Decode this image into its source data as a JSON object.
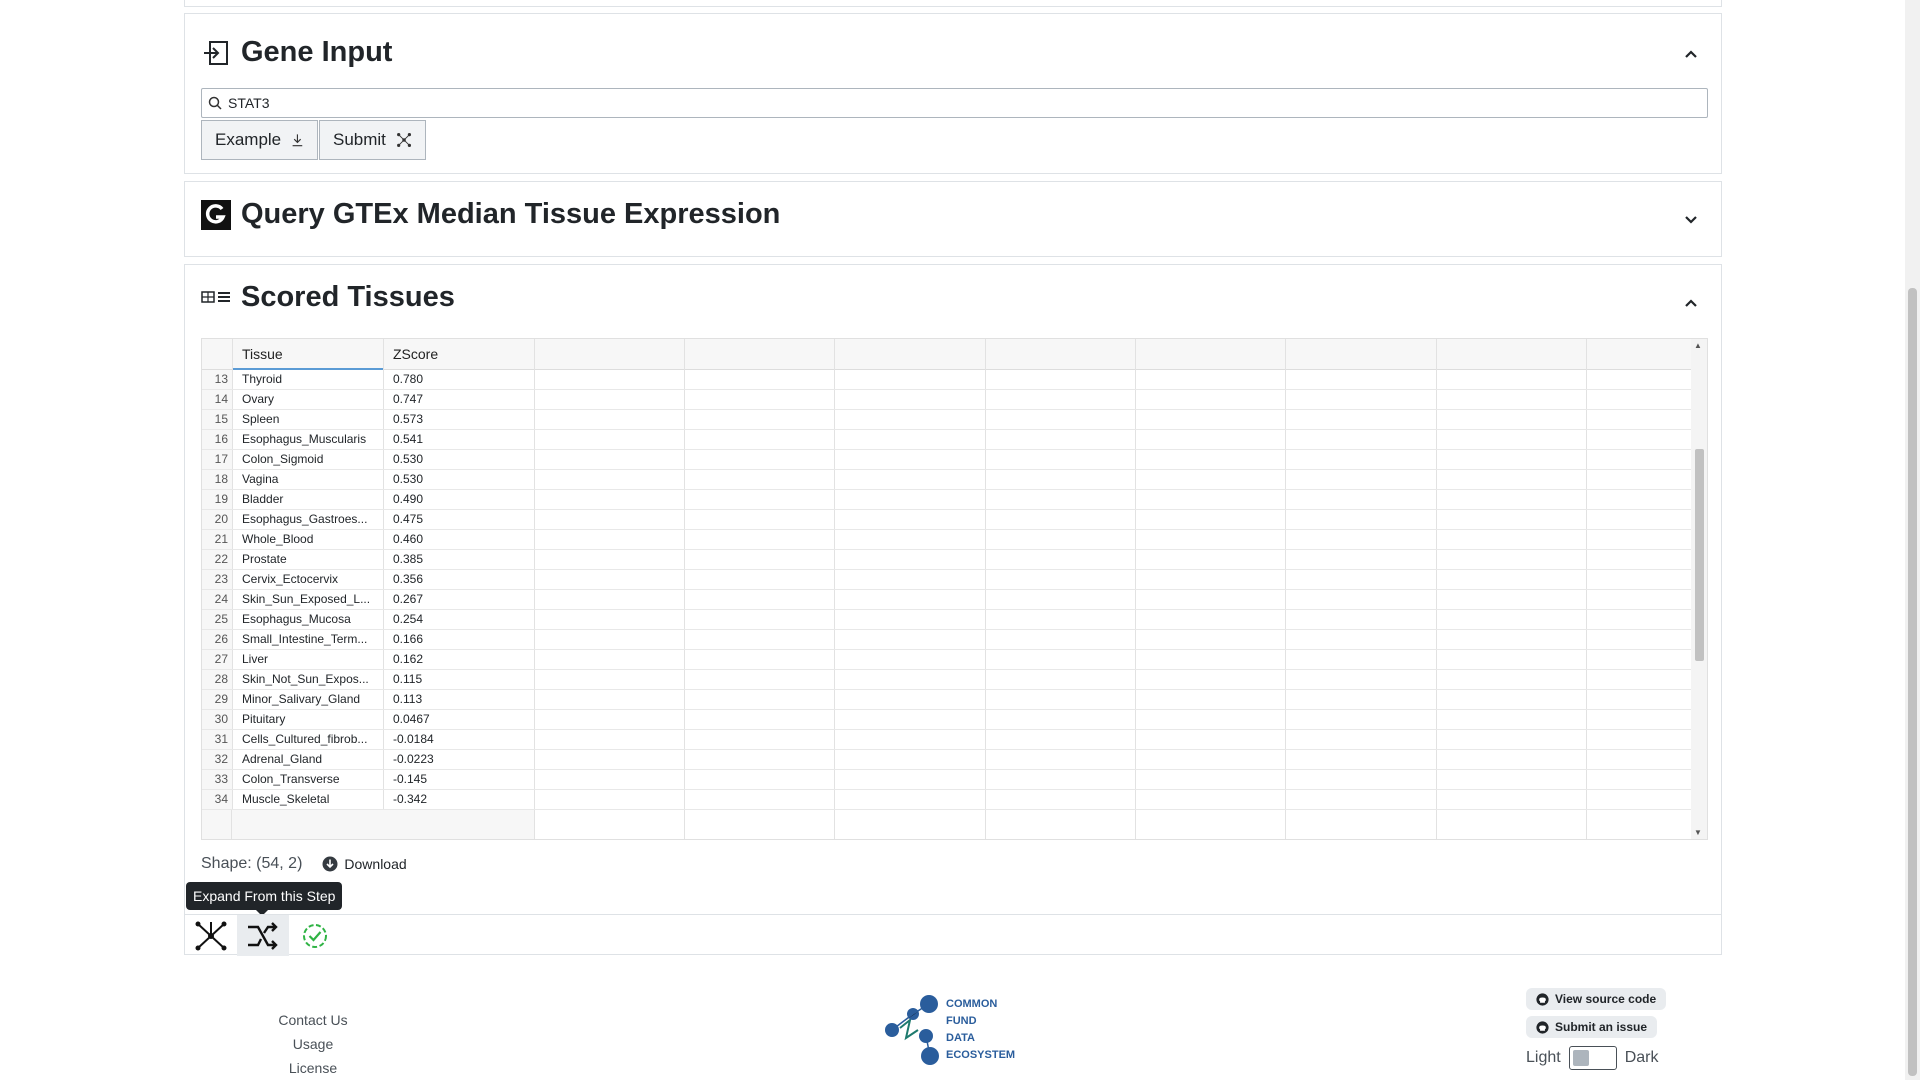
{
  "gene_input": {
    "title": "Gene Input",
    "search_value": "STAT3",
    "example_label": "Example",
    "submit_label": "Submit"
  },
  "gtex": {
    "title": "Query GTEx Median Tissue Expression"
  },
  "scored": {
    "title": "Scored Tissues",
    "columns": [
      "Tissue",
      "ZScore"
    ],
    "rows": [
      {
        "idx": "13",
        "tissue": "Thyroid",
        "zscore": "0.780"
      },
      {
        "idx": "14",
        "tissue": "Ovary",
        "zscore": "0.747"
      },
      {
        "idx": "15",
        "tissue": "Spleen",
        "zscore": "0.573"
      },
      {
        "idx": "16",
        "tissue": "Esophagus_Muscularis",
        "zscore": "0.541"
      },
      {
        "idx": "17",
        "tissue": "Colon_Sigmoid",
        "zscore": "0.530"
      },
      {
        "idx": "18",
        "tissue": "Vagina",
        "zscore": "0.530"
      },
      {
        "idx": "19",
        "tissue": "Bladder",
        "zscore": "0.490"
      },
      {
        "idx": "20",
        "tissue": "Esophagus_Gastroes...",
        "zscore": "0.475"
      },
      {
        "idx": "21",
        "tissue": "Whole_Blood",
        "zscore": "0.460"
      },
      {
        "idx": "22",
        "tissue": "Prostate",
        "zscore": "0.385"
      },
      {
        "idx": "23",
        "tissue": "Cervix_Ectocervix",
        "zscore": "0.356"
      },
      {
        "idx": "24",
        "tissue": "Skin_Sun_Exposed_L...",
        "zscore": "0.267"
      },
      {
        "idx": "25",
        "tissue": "Esophagus_Mucosa",
        "zscore": "0.254"
      },
      {
        "idx": "26",
        "tissue": "Small_Intestine_Term...",
        "zscore": "0.166"
      },
      {
        "idx": "27",
        "tissue": "Liver",
        "zscore": "0.162"
      },
      {
        "idx": "28",
        "tissue": "Skin_Not_Sun_Expos...",
        "zscore": "0.115"
      },
      {
        "idx": "29",
        "tissue": "Minor_Salivary_Gland",
        "zscore": "0.113"
      },
      {
        "idx": "30",
        "tissue": "Pituitary",
        "zscore": "0.0467"
      },
      {
        "idx": "31",
        "tissue": "Cells_Cultured_fibrob...",
        "zscore": "-0.0184"
      },
      {
        "idx": "32",
        "tissue": "Adrenal_Gland",
        "zscore": "-0.0223"
      },
      {
        "idx": "33",
        "tissue": "Colon_Transverse",
        "zscore": "-0.145"
      },
      {
        "idx": "34",
        "tissue": "Muscle_Skeletal",
        "zscore": "-0.342"
      }
    ],
    "shape_text": "Shape: (54, 2)",
    "download_label": "Download",
    "tooltip": "Expand From this Step"
  },
  "footer": {
    "contact": "Contact Us",
    "license": "Usage License",
    "logo_lines": [
      "COMMON",
      "FUND",
      "DATA",
      "ECOSYSTEM"
    ],
    "view_source": "View source code",
    "submit_issue": "Submit an issue",
    "theme_light": "Light",
    "theme_dark": "Dark"
  },
  "colors": {
    "logo_blue": "#2a5d9c",
    "logo_teal": "#1e7a6e",
    "check_green": "#2fb344"
  }
}
